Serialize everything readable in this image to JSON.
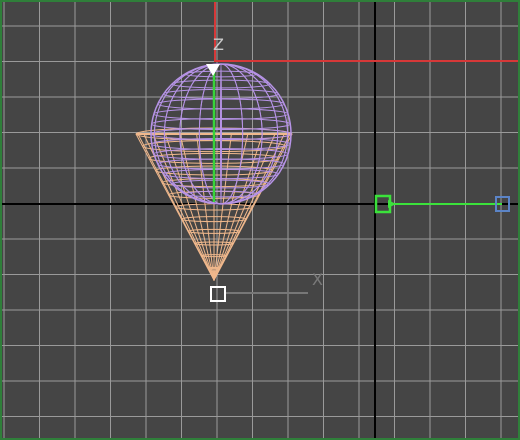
{
  "viewport": {
    "colors": {
      "background": "#454545",
      "grid": "#9a9a9a",
      "world_axis": "#000000",
      "active_border": "#2f7f3a",
      "sphere_wire": "#b693e6",
      "cone_wire": "#f0b88c",
      "target_link": "#3be23b",
      "helper_box": "#5b84c7",
      "gizmo_red": "#d63838",
      "gizmo_green": "#37d43a"
    }
  },
  "gizmo": {
    "z_label": "Z",
    "x_label": "X"
  }
}
